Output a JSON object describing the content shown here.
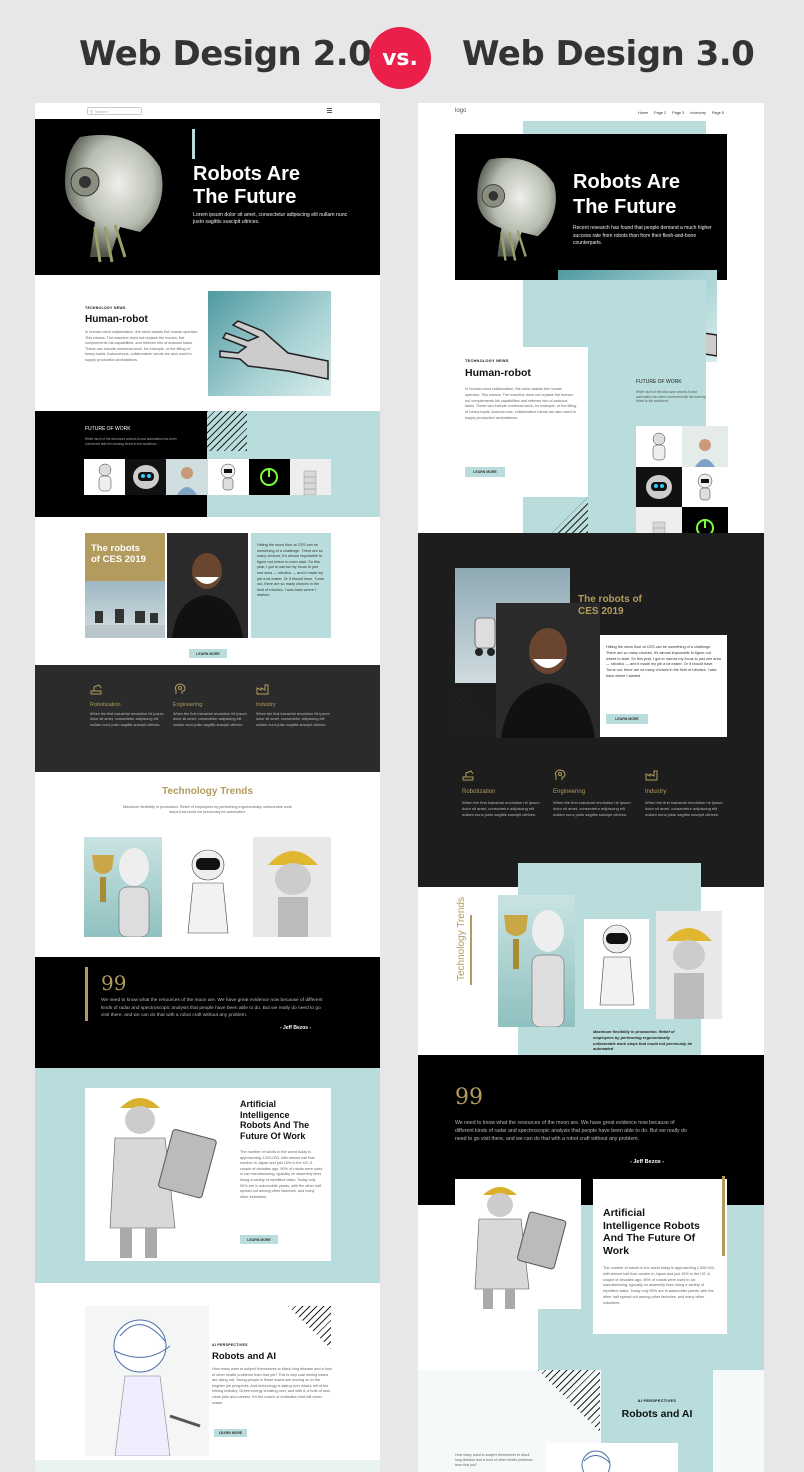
{
  "header": {
    "left_title": "Web Design 2.0",
    "vs": "vs.",
    "right_title": "Web Design 3.0"
  },
  "colors": {
    "mint": "#b9dddc",
    "gold": "#b39b5e",
    "vs_red": "#ea1f4a",
    "dark": "#2b2b2b"
  },
  "left": {
    "search_placeholder": "Search",
    "hero": {
      "title_1": "Robots Are",
      "title_2": "The Future",
      "text": "Lorem ipsum dolor sit amet, consectetur adipiscing elit nullam nunc justo sagittis suscipit ultrices."
    },
    "human": {
      "kicker": "TECHNOLOGY NEWS",
      "title": "Human-robot",
      "text": "In human-robot collaboration, the robot assists the human operator. This means: The machine does not replace the human, but complements his capabilities, and relieves him of arduous tasks. These can include overhead work, for example, or the lifting of heavy loads. Autonomous, collaborative robots are also used to supply production workstations."
    },
    "future": {
      "title": "FUTURE OF WORK",
      "text": "While much of the discourse around AI and automation has been concerned with the looming threat to the workforce..."
    },
    "ces": {
      "title_1": "The robots",
      "title_2": "of CES 2019",
      "text": "Hitting the show floor at CES can be something of a challenge. There are so many choices, it's almost impossible to figure out where to even start. So this year, I got to narrow my focus to just one area — robotics — and it made my job a lot easier. Or it should have. Turns out, there are so many choices in the field of robotics, I was back where I started.",
      "button": "LEARN MORE"
    },
    "features": [
      {
        "icon": "robot-arm-icon",
        "title": "Robotization",
        "text": "When the first industrial revolution hit Ipsum dolor sit amet, consectetur adipiscing elit nullam nunc justo sagittis suscipit ultrices."
      },
      {
        "icon": "brain-gear-icon",
        "title": "Engineering",
        "text": "When the first industrial revolution hit Ipsum dolor sit amet, consectetur adipiscing elit nullam nunc justo sagittis suscipit ultrices."
      },
      {
        "icon": "factory-icon",
        "title": "Industry",
        "text": "When the first industrial revolution hit Ipsum dolor sit amet, consectetur adipiscing elit nullam nunc justo sagittis suscipit ultrices."
      }
    ],
    "trends": {
      "title": "Technology Trends",
      "text": "Maximum flexibility in production. Relief of employees by performing ergonomically unfavorable work steps that could not previously be automated."
    },
    "quote": {
      "mark": "99",
      "text": "We need to know what the resources of the moon are. We have great evidence now because of different kinds of radar and spectroscopic analysis that people have been able to do. But we really do need to go visit there, and we can do that with a robot craft without any problem.",
      "author": "- Jeff Bezos -"
    },
    "ai": {
      "title_1": "Artificial",
      "title_2": "Intelligence",
      "title_3": "Robots And The",
      "title_4": "Future Of Work",
      "text": "The number of robots in the world today is approaching 1,000,000, with almost half that number in Japan and just 15% in the US. A couple of decades ago, 90% of robots were used in car manufacturing, typically on assembly lines doing a variety of repetitive tasks. Today only 50% are in automobile plants, with the other half spread out among other factories, and many other industries.",
      "button": "LEARN MORE"
    },
    "persp": {
      "kicker": "AI PERSPECTIVES",
      "title": "Robots and AI",
      "text": "How many want to subject themselves to black lung disease and a host of other health problems from that job? This is why coal mining towns are dying out. Young people in these towns are moving on to the brighter job prospects. And technology is taking over what's left of the mining industry. Green energy is taking over, and with it, a host of new, clean jobs and careers. It's the march of civilization that will never cease.",
      "button": "LEARN MORE"
    }
  },
  "right": {
    "logo": "logo",
    "nav": [
      "Home",
      "Page 2",
      "Page 3",
      "Inventory",
      "Page 5"
    ],
    "hero": {
      "title_1": "Robots Are",
      "title_2": "The Future",
      "text": "Recent research has found that people demand a much higher success rate from robots than from their flesh-and-bone counterparts."
    },
    "human": {
      "kicker": "TECHNOLOGY NEWS",
      "title": "Human-robot",
      "text": "In human-robot collaboration, the robot assists the human operator. This means: The machine does not replace the human, but complements his capabilities and relieves him of arduous tasks. These can include overhead work, for example, or the lifting of heavy loads. Autonomous, collaborative robots are also used to supply production workstations.",
      "button": "LEARN MORE"
    },
    "future": {
      "title": "FUTURE OF WORK",
      "text": "While much of the discourse around AI and automation has been concerned with the looming threat to the workforce..."
    },
    "ces": {
      "title_1": "The robots of",
      "title_2": "CES 2019",
      "text": "Hitting the show floor at CES can be something of a challenge. There are so many choices, it's almost impossible to figure out where to start. So this year, I got to narrow my focus to just one area — robotics — and it made my job a lot easier. Or it should have. Turns out, there are so many choices in the field of robotics, I was back where I started.",
      "button": "LEARN MORE"
    },
    "features": [
      {
        "icon": "robot-arm-icon",
        "title": "Robotization",
        "text": "When the first industrial revolution hit Ipsum dolor sit amet, consectetur adipiscing elit nullam nunc justo sagittis suscipit ultrices."
      },
      {
        "icon": "brain-gear-icon",
        "title": "Engineering",
        "text": "When the first industrial revolution hit Ipsum dolor sit amet, consectetur adipiscing elit nullam nunc justo sagittis suscipit ultrices."
      },
      {
        "icon": "factory-icon",
        "title": "Industry",
        "text": "When the first industrial revolution hit Ipsum dolor sit amet, consectetur adipiscing elit nullam nunc justo sagittis suscipit ultrices."
      }
    ],
    "trends": {
      "title": "Technology Trends",
      "text": "Maximum flexibility in production. Relief of employees by performing ergonomically unfavorable work steps that could not previously be automated"
    },
    "quote": {
      "mark": "99",
      "text": "We need to know what the resources of the moon are. We have great evidence now because of different kinds of radar and spectroscopic analysis that people have been able to do. But we really do need to go visit there, and we can do that with a robot craft without any problem.",
      "author": "- Jeff Bezos -"
    },
    "ai": {
      "title_1": "Artificial",
      "title_2": "Intelligence Robots",
      "title_3": "And The Future Of",
      "title_4": "Work",
      "text": "The number of robots in the world today is approaching 1,000,000, with almost half that number in Japan and just 15% in the US. A couple of decades ago, 90% of robots were used in car manufacturing, typically on assembly lines doing a variety of repetitive tasks. Today only 50% are in automobile plants, with the other half spread out among other factories, and many other industries."
    },
    "persp": {
      "kicker": "AI PERSPECTIVES",
      "title": "Robots and AI",
      "text": "How many want to subject themselves to black lung disease and a host of other health problems from that job?"
    }
  }
}
